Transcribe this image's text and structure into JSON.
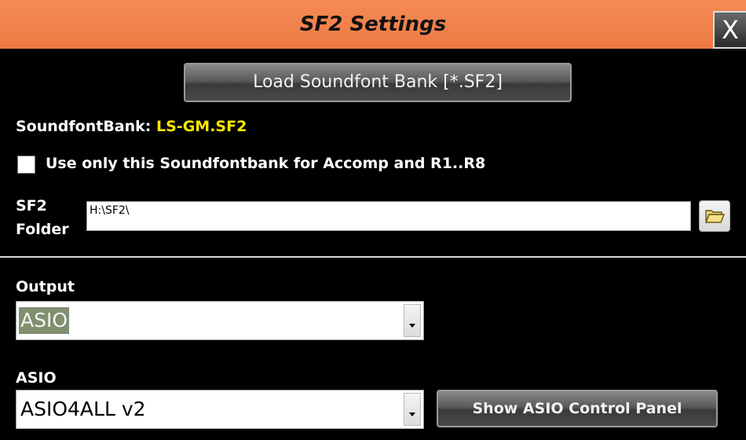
{
  "window": {
    "title": "SF2 Settings",
    "close_label": "X",
    "titlebar_color": "#f07f4a"
  },
  "soundfont": {
    "load_button_label": "Load Soundfont Bank [*.SF2]",
    "bank_label": "SoundfontBank:",
    "bank_value": "LS-GM.SF2",
    "bank_value_color": "#ffe800"
  },
  "options": {
    "use_only_label": "Use only this Soundfontbank for Accomp and R1..R8",
    "use_only_checked": false
  },
  "folder": {
    "label_line1": "SF2",
    "label_line2": "Folder",
    "value": "H:\\SF2\\",
    "browse_icon": "folder-open-icon"
  },
  "output": {
    "label": "Output",
    "selected": "ASIO"
  },
  "asio": {
    "label": "ASIO",
    "selected": "ASIO4ALL v2",
    "control_panel_label": "Show ASIO Control Panel"
  }
}
